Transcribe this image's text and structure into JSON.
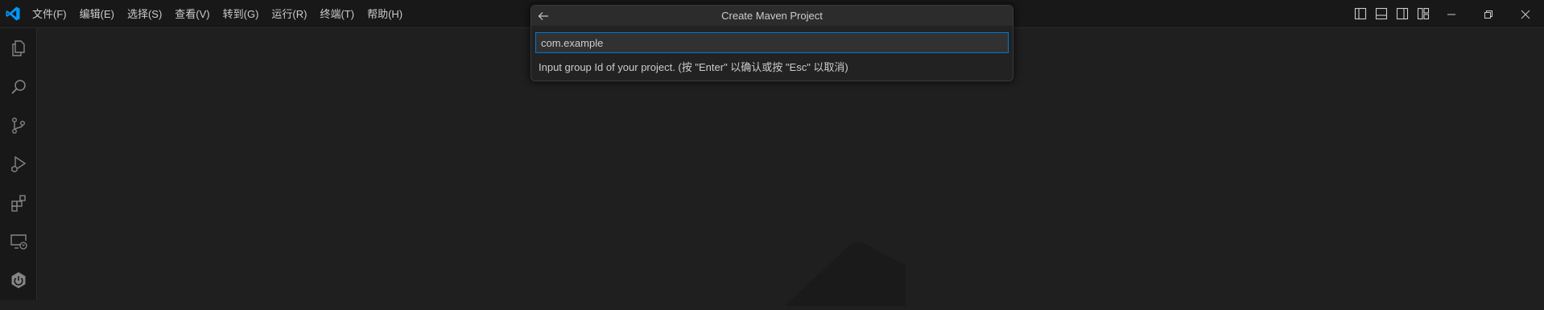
{
  "titlebar": {
    "app_icon": "vscode-logo-icon",
    "menu": [
      {
        "label": "文件(F)"
      },
      {
        "label": "编辑(E)"
      },
      {
        "label": "选择(S)"
      },
      {
        "label": "查看(V)"
      },
      {
        "label": "转到(G)"
      },
      {
        "label": "运行(R)"
      },
      {
        "label": "终端(T)"
      },
      {
        "label": "帮助(H)"
      }
    ],
    "layout_controls": [
      "toggle-primary-sidebar-icon",
      "toggle-panel-icon",
      "toggle-secondary-sidebar-icon",
      "customize-layout-icon"
    ],
    "window_controls": [
      "minimize-icon",
      "restore-icon",
      "close-icon"
    ]
  },
  "activity_bar": {
    "items": [
      "explorer-icon",
      "search-icon",
      "source-control-icon",
      "run-and-debug-icon",
      "extensions-icon",
      "remote-explorer-icon",
      "spring-boot-icon"
    ]
  },
  "quick_input": {
    "title": "Create Maven Project",
    "back_icon": "arrow-left-icon",
    "value": "com.example",
    "message": "Input group Id of your project. (按 \"Enter\" 以确认或按 \"Esc\" 以取消)"
  },
  "colors": {
    "background": "#1f1f1f",
    "titlebar": "#181818",
    "accent": "#0078d4",
    "logo": "#0098ff"
  }
}
